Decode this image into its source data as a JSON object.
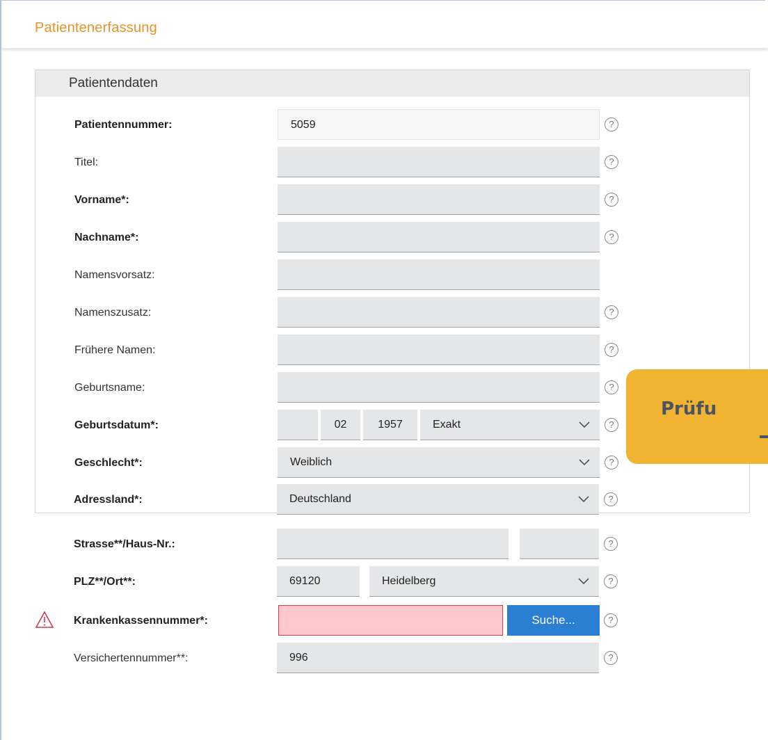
{
  "header": {
    "title": "Patientenerfassung"
  },
  "panel": {
    "title": "Patientendaten"
  },
  "fields": {
    "patientennummer": {
      "label": "Patientennummer:",
      "value": "5059"
    },
    "titel": {
      "label": "Titel:",
      "value": ""
    },
    "vorname": {
      "label": "Vorname*:",
      "value": ""
    },
    "nachname": {
      "label": "Nachname*:",
      "value": ""
    },
    "namensvorsatz": {
      "label": "Namensvorsatz:",
      "value": ""
    },
    "namenszusatz": {
      "label": "Namenszusatz:",
      "value": ""
    },
    "fruehere_namen": {
      "label": "Frühere Namen:",
      "value": ""
    },
    "geburtsname": {
      "label": "Geburtsname:",
      "value": ""
    },
    "geburtsdatum": {
      "label": "Geburtsdatum*:",
      "day": "",
      "month": "02",
      "year": "1957",
      "precision": "Exakt"
    },
    "geschlecht": {
      "label": "Geschlecht*:",
      "value": "Weiblich"
    },
    "adressland": {
      "label": "Adressland*:",
      "value": "Deutschland"
    },
    "strasse": {
      "label": "Strasse**/Haus-Nr.:",
      "street": "",
      "number": ""
    },
    "plz_ort": {
      "label": "PLZ**/Ort**:",
      "plz": "69120",
      "ort": "Heidelberg"
    },
    "krankenkassennummer": {
      "label": "Krankenkassennummer*:",
      "value": "",
      "search_label": "Suche..."
    },
    "versichertennummer": {
      "label": "Versichertennummer**:",
      "value": "996"
    }
  },
  "help_glyph": "?",
  "callout": {
    "text": "Prüfu"
  },
  "icons": {
    "help": "help-circle-icon",
    "dropdown": "chevron-down-icon",
    "warning": "warning-triangle-icon"
  },
  "colors": {
    "accent_title": "#e8922a",
    "button": "#2a7fd3",
    "error_fill": "#ffc8cc",
    "error_border": "#d63a4a",
    "warning": "#d63a4a",
    "callout": "#f0b432"
  }
}
